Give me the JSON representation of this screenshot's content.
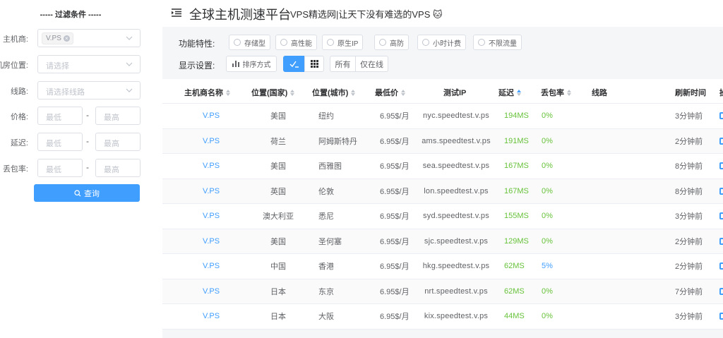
{
  "filter": {
    "title": "-----  过滤条件  -----",
    "host_label": "主机商:",
    "host_tag": "V.PS",
    "location_label": "机房位置:",
    "location_placeholder": "请选择",
    "line_label": "线路:",
    "line_placeholder": "请选择线路",
    "price_label": "价格:",
    "latency_label": "延迟:",
    "loss_label": "丢包率:",
    "min_placeholder": "最低",
    "max_placeholder": "最高",
    "dash": "-",
    "search_label": "查询"
  },
  "header": {
    "title": "全球主机测速平台",
    "subtitle": "VPS精选网|让天下没有难选的VPS 🐱"
  },
  "toolbar": {
    "features_label": "功能特性:",
    "features": [
      "存储型",
      "高性能",
      "原生IP",
      "高防",
      "小时计费",
      "不限流量"
    ],
    "display_label": "显示设置:",
    "sort_label": "排序方式",
    "all_label": "所有",
    "online_label": "仅在线"
  },
  "table": {
    "columns": {
      "host": "主机商名称",
      "country": "位置(国家)",
      "city": "位置(城市)",
      "price": "最低价",
      "ip": "测试IP",
      "latency": "延迟",
      "loss": "丢包率",
      "line": "线路",
      "refresh": "刷新时间",
      "op": "操"
    },
    "rows": [
      {
        "host": "V.PS",
        "country": "美国",
        "city": "纽约",
        "price": "6.95$/月",
        "ip": "nyc.speedtest.v.ps",
        "latency": "194MS",
        "loss": "0%",
        "refresh": "3分钟前"
      },
      {
        "host": "V.PS",
        "country": "荷兰",
        "city": "阿姆斯特丹",
        "price": "6.95$/月",
        "ip": "ams.speedtest.v.ps",
        "latency": "191MS",
        "loss": "0%",
        "refresh": "2分钟前"
      },
      {
        "host": "V.PS",
        "country": "美国",
        "city": "西雅图",
        "price": "6.95$/月",
        "ip": "sea.speedtest.v.ps",
        "latency": "167MS",
        "loss": "0%",
        "refresh": "8分钟前"
      },
      {
        "host": "V.PS",
        "country": "英国",
        "city": "伦敦",
        "price": "6.95$/月",
        "ip": "lon.speedtest.v.ps",
        "latency": "167MS",
        "loss": "0%",
        "refresh": "8分钟前"
      },
      {
        "host": "V.PS",
        "country": "澳大利亚",
        "city": "悉尼",
        "price": "6.95$/月",
        "ip": "syd.speedtest.v.ps",
        "latency": "155MS",
        "loss": "0%",
        "refresh": "3分钟前"
      },
      {
        "host": "V.PS",
        "country": "美国",
        "city": "圣何塞",
        "price": "6.95$/月",
        "ip": "sjc.speedtest.v.ps",
        "latency": "129MS",
        "loss": "0%",
        "refresh": "2分钟前"
      },
      {
        "host": "V.PS",
        "country": "中国",
        "city": "香港",
        "price": "6.95$/月",
        "ip": "hkg.speedtest.v.ps",
        "latency": "62MS",
        "loss": "5%",
        "refresh": "2分钟前"
      },
      {
        "host": "V.PS",
        "country": "日本",
        "city": "东京",
        "price": "6.95$/月",
        "ip": "nrt.speedtest.v.ps",
        "latency": "62MS",
        "loss": "0%",
        "refresh": "7分钟前"
      },
      {
        "host": "V.PS",
        "country": "日本",
        "city": "大阪",
        "price": "6.95$/月",
        "ip": "kix.speedtest.v.ps",
        "latency": "44MS",
        "loss": "0%",
        "refresh": "3分钟前"
      }
    ]
  },
  "colors": {
    "primary": "#409eff",
    "success": "#67c23a",
    "text": "#606266"
  }
}
